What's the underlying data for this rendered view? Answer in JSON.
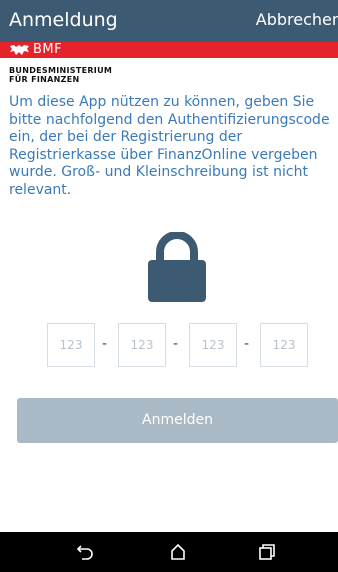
{
  "header": {
    "title": "Anmeldung",
    "cancel_label": "Abbrechen"
  },
  "brand": {
    "bar_color": "#e4232b",
    "logo_text": "BMF",
    "ministry_line1": "BUNDESMINISTERIUM",
    "ministry_line2": "FÜR FINANZEN"
  },
  "intro_text": "Um diese App nützen zu können, geben Sie bitte nachfolgend den Authentifizierungscode ein, der bei der Registrierung der Registrierkasse über FinanzOnline vergeben wurde. Groß- und Kleinschreibung ist nicht relevant.",
  "lock_icon": "lock-icon",
  "code": {
    "field1_placeholder": "123",
    "field2_placeholder": "123",
    "field3_placeholder": "123",
    "field4_placeholder": "123",
    "separator": "-"
  },
  "login_label": "Anmelden",
  "colors": {
    "header": "#3d5a73",
    "text_accent": "#3a7ab8",
    "button_disabled": "#a9b9c6"
  },
  "nav": {
    "back_icon": "back-icon",
    "home_icon": "home-icon",
    "recents_icon": "recents-icon"
  }
}
